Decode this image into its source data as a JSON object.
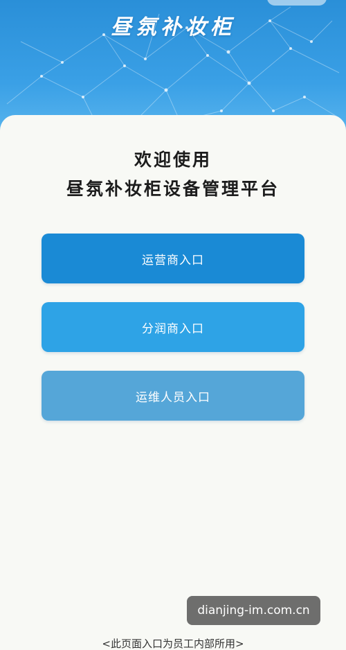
{
  "header": {
    "title": "昼氛补妆柜"
  },
  "welcome": {
    "line1": "欢迎使用",
    "line2": "昼氛补妆柜设备管理平台"
  },
  "entries": {
    "operator_label": "运营商入口",
    "profit_share_label": "分润商入口",
    "maintenance_label": "运维人员入口"
  },
  "watermark": {
    "text": "dianjing-im.com.cn"
  },
  "footer": {
    "note": "<此页面入口为员工内部所用>"
  },
  "colors": {
    "header_blue": "#2a8fd8",
    "operator_button": "#1a8ad5",
    "profit_button": "#2ea3e6",
    "maintenance_button": "#55a6d8"
  }
}
